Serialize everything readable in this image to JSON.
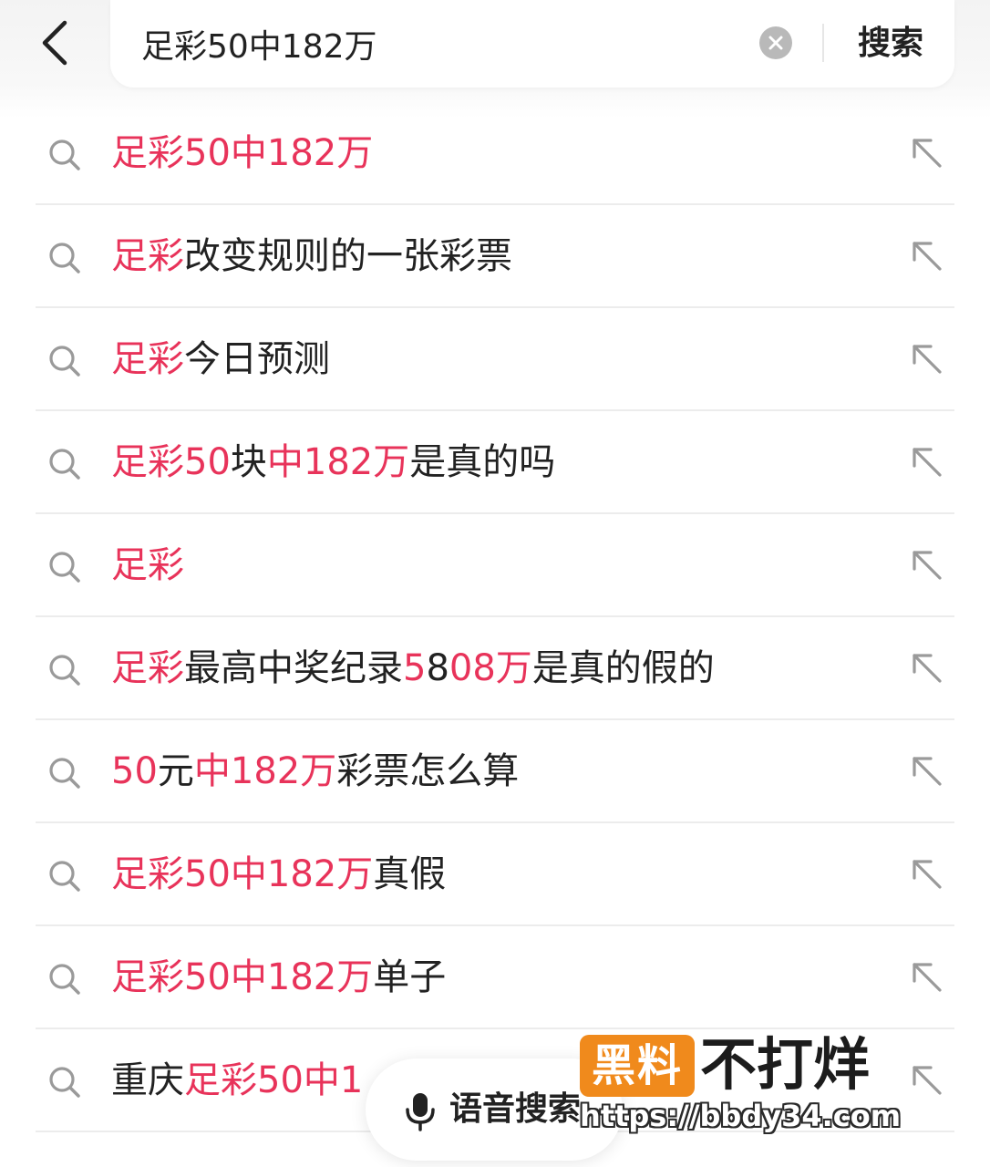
{
  "header": {
    "back_icon": "chevron-left-icon",
    "search_value": "足彩50中182万",
    "clear_icon": "clear-x-icon",
    "search_button_label": "搜索"
  },
  "suggestions": [
    {
      "segments": [
        {
          "text": "足彩50中182万",
          "hl": true
        }
      ]
    },
    {
      "segments": [
        {
          "text": "足彩",
          "hl": true
        },
        {
          "text": "改变规则的一张彩票",
          "hl": false
        }
      ]
    },
    {
      "segments": [
        {
          "text": "足彩",
          "hl": true
        },
        {
          "text": "今日预测",
          "hl": false
        }
      ]
    },
    {
      "segments": [
        {
          "text": "足彩50",
          "hl": true
        },
        {
          "text": "块",
          "hl": false
        },
        {
          "text": "中182万",
          "hl": true
        },
        {
          "text": "是真的吗",
          "hl": false
        }
      ]
    },
    {
      "segments": [
        {
          "text": "足彩",
          "hl": true
        }
      ]
    },
    {
      "segments": [
        {
          "text": "足彩",
          "hl": true
        },
        {
          "text": "最高中奖纪录",
          "hl": false
        },
        {
          "text": "5",
          "hl": true
        },
        {
          "text": "8",
          "hl": false
        },
        {
          "text": "08万",
          "hl": true
        },
        {
          "text": "是真的假的",
          "hl": false
        }
      ]
    },
    {
      "segments": [
        {
          "text": "50",
          "hl": true
        },
        {
          "text": "元",
          "hl": false
        },
        {
          "text": "中182万",
          "hl": true
        },
        {
          "text": "彩票怎么算",
          "hl": false
        }
      ]
    },
    {
      "segments": [
        {
          "text": "足彩50中182万",
          "hl": true
        },
        {
          "text": "真假",
          "hl": false
        }
      ]
    },
    {
      "segments": [
        {
          "text": "足彩50中182万",
          "hl": true
        },
        {
          "text": "单子",
          "hl": false
        }
      ]
    },
    {
      "segments": [
        {
          "text": "重庆",
          "hl": false
        },
        {
          "text": "足彩50中1",
          "hl": true
        }
      ]
    }
  ],
  "suggestion_icons": {
    "leading": "search-icon",
    "trailing": "arrow-up-left-icon"
  },
  "voice_search": {
    "icon": "microphone-icon",
    "label": "语音搜索"
  },
  "watermark": {
    "box_text": "黑料",
    "title": "不打烊",
    "url": "https://bbdy34.com"
  },
  "colors": {
    "highlight": "#e8335a",
    "text": "#222222",
    "divider": "#ececec",
    "watermark_orange": "#f08a1c"
  }
}
